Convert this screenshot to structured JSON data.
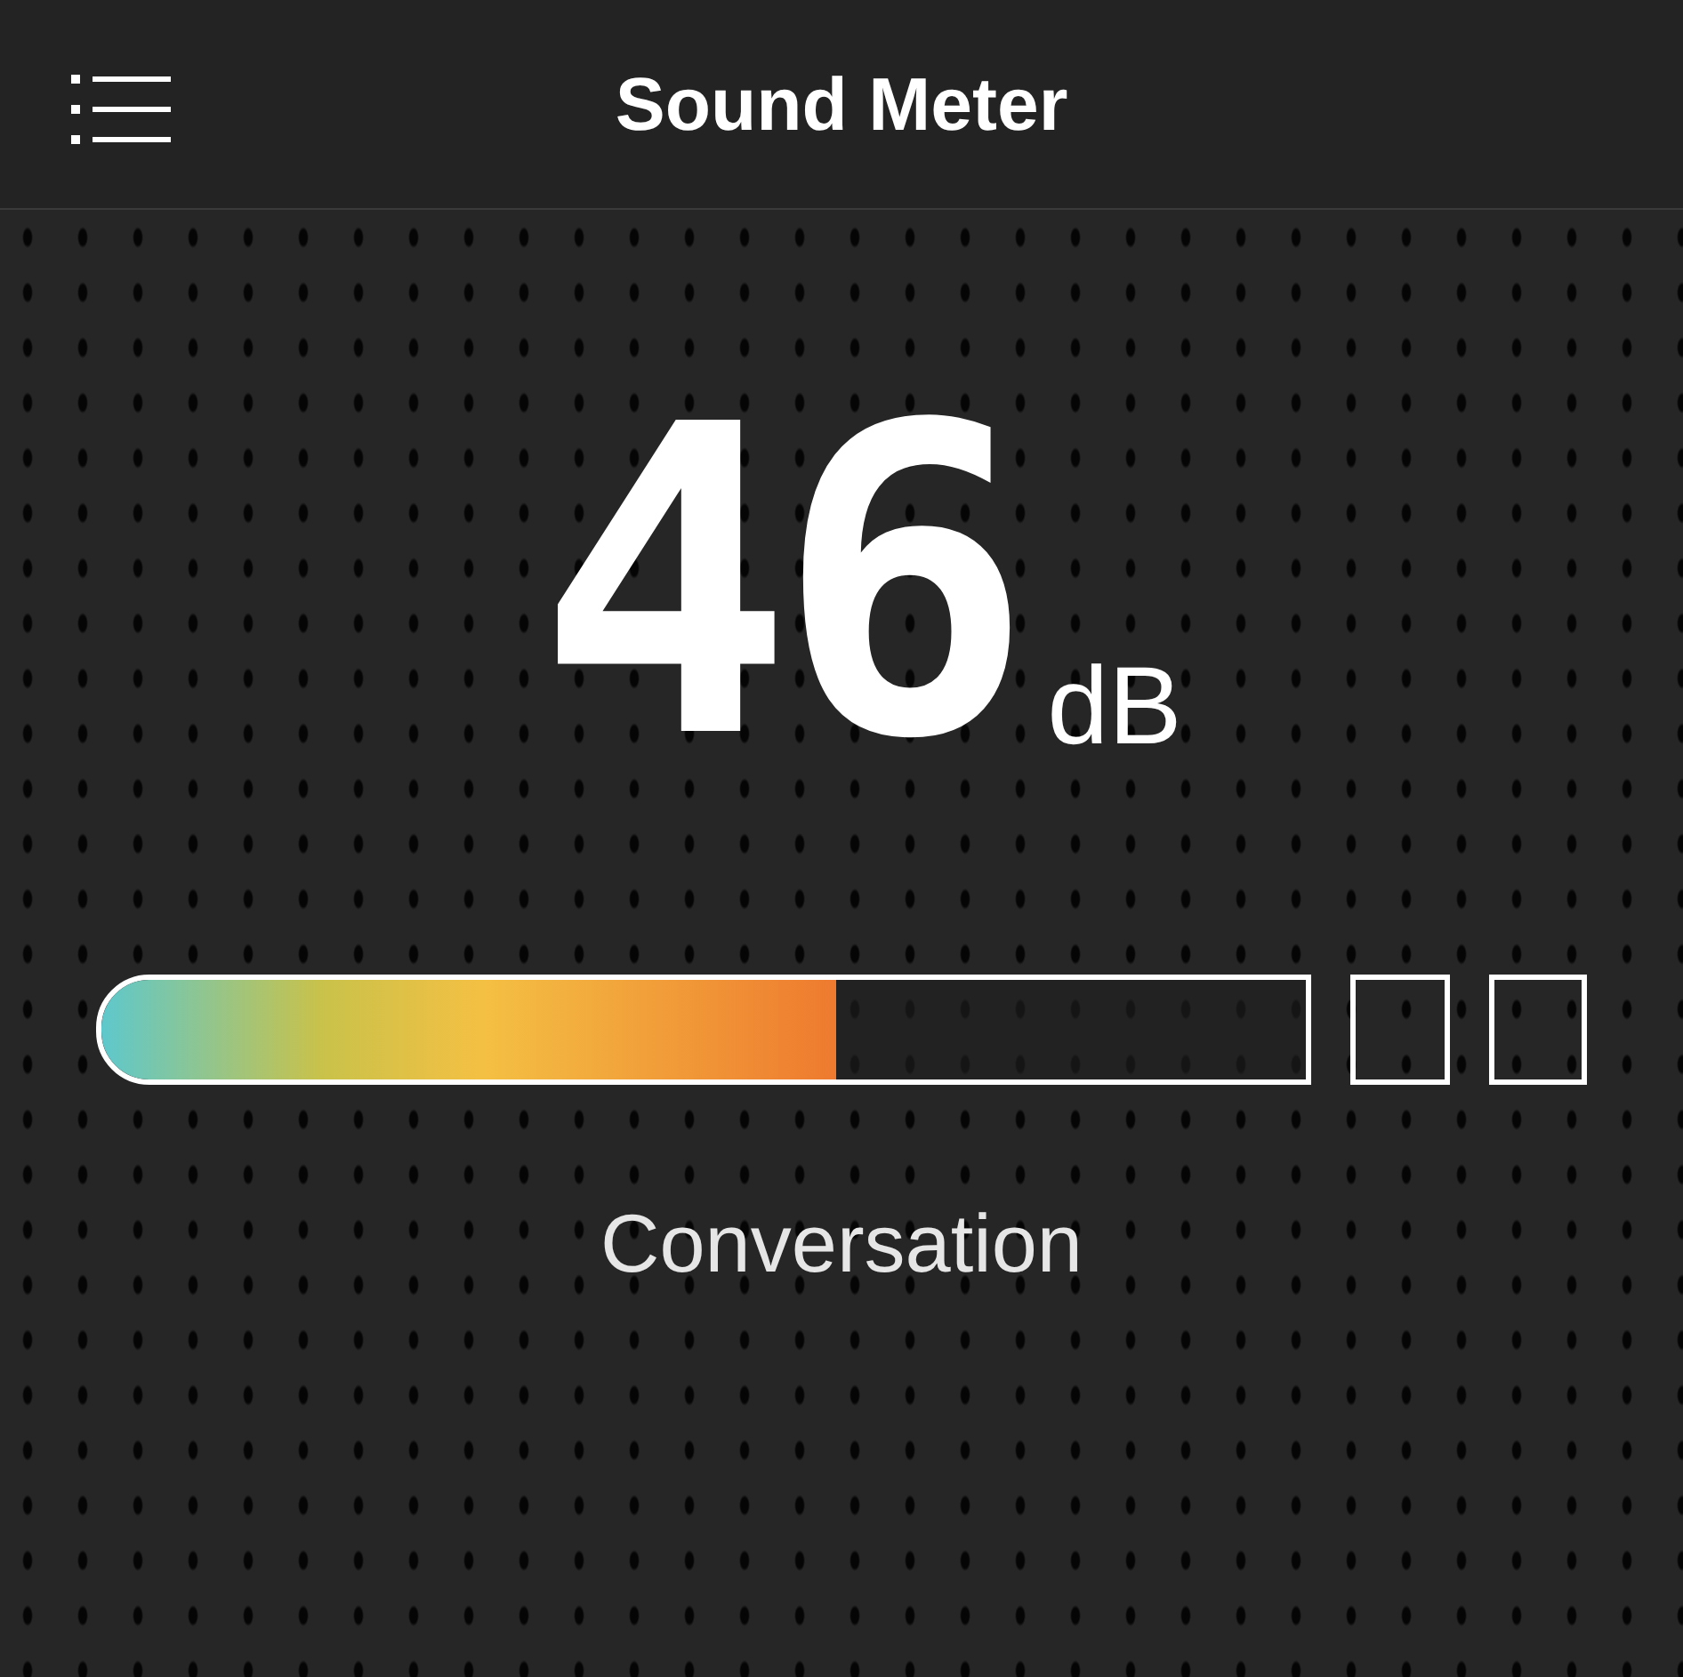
{
  "header": {
    "title": "Sound Meter"
  },
  "reading": {
    "value": "46",
    "unit": "dB"
  },
  "meter": {
    "level": 0.61
  },
  "category": "Conversation"
}
